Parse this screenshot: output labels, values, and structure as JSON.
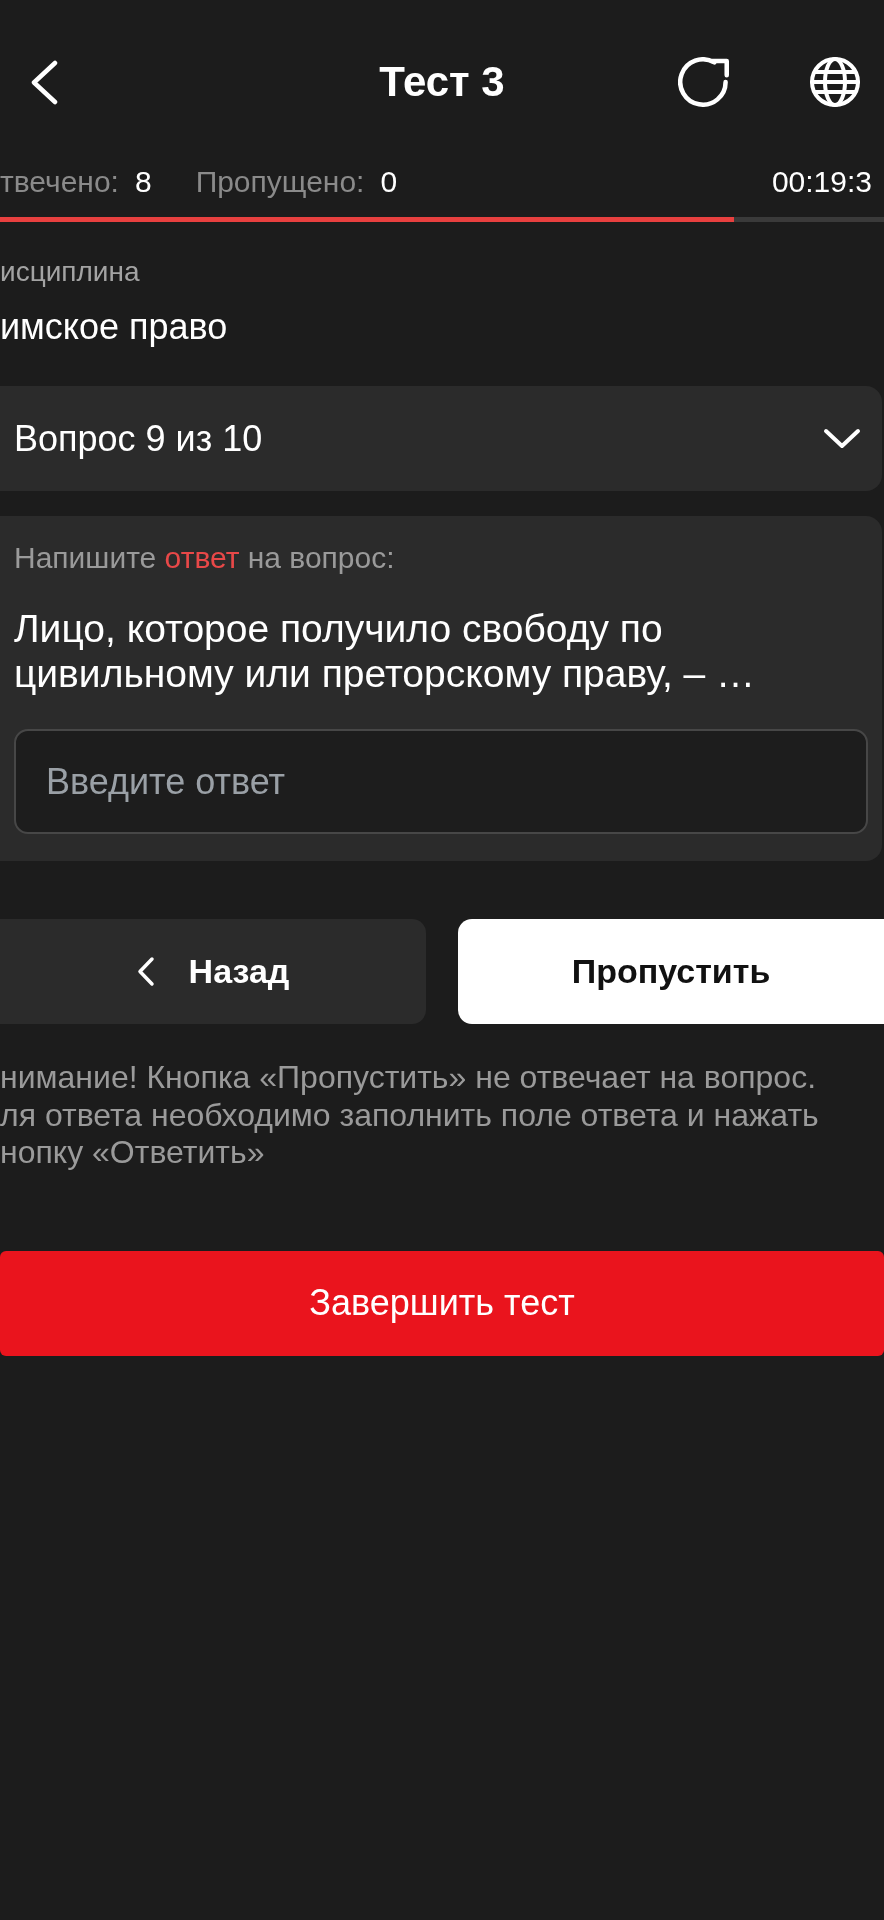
{
  "header": {
    "title": "Тест 3"
  },
  "stats": {
    "answered_label": "твечено:",
    "answered_count": "8",
    "skipped_label": "Пропущено:",
    "skipped_count": "0",
    "timer": "00:19:3"
  },
  "progress": {
    "level": 0.83
  },
  "discipline": {
    "label": "исциплина",
    "name": "имское право"
  },
  "question_selector": {
    "label": "Вопрос 9 из 10"
  },
  "question_card": {
    "prompt": [
      {
        "text": "Напишите",
        "highlighted": false
      },
      {
        "text": "ответ",
        "highlighted": true
      },
      {
        "text": "на вопрос:",
        "highlighted": false
      }
    ],
    "question": "Лицо, которое получило свободу по цивильному или преторскому праву, – …",
    "answer_field": {
      "placeholder": "Введите ответ"
    }
  },
  "buttons": [
    {
      "kind": "back",
      "label": "Назад"
    },
    {
      "kind": "skip",
      "label": "Пропустить"
    }
  ],
  "warning": {
    "lines": [
      "нимание! Кнопка «Пропустить» не отвечает на вопрос.",
      "ля ответа необходимо заполнить поле ответа и нажать",
      "нопку «Ответить»"
    ]
  },
  "finish_button": {
    "label": "Завершить тест"
  }
}
